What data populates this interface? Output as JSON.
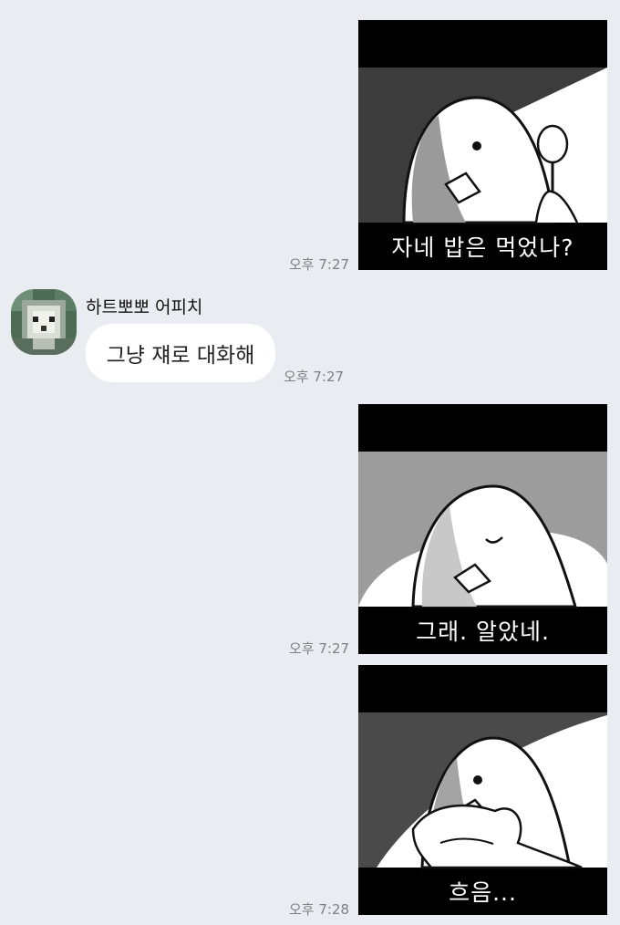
{
  "messages": [
    {
      "kind": "sticker",
      "side": "right",
      "caption": "자네 밥은 먹었나?",
      "time": "오후 7:27"
    },
    {
      "kind": "text",
      "side": "left",
      "sender": "하트뽀뽀 어피치",
      "text": "그냥 쟤로 대화해",
      "time": "오후 7:27"
    },
    {
      "kind": "sticker",
      "side": "right",
      "caption": "그래. 알았네.",
      "time": "오후 7:27"
    },
    {
      "kind": "sticker",
      "side": "right",
      "caption": "흐음...",
      "time": "오후 7:28"
    }
  ],
  "colors": {
    "chat_background": "#e9edf2",
    "bubble_background": "#ffffff",
    "time_text": "#7c7f84",
    "sticker_frame": "#000000"
  },
  "icons": {
    "avatar": "pixelated-profile-photo",
    "sticker": "bird-character-sticker"
  }
}
